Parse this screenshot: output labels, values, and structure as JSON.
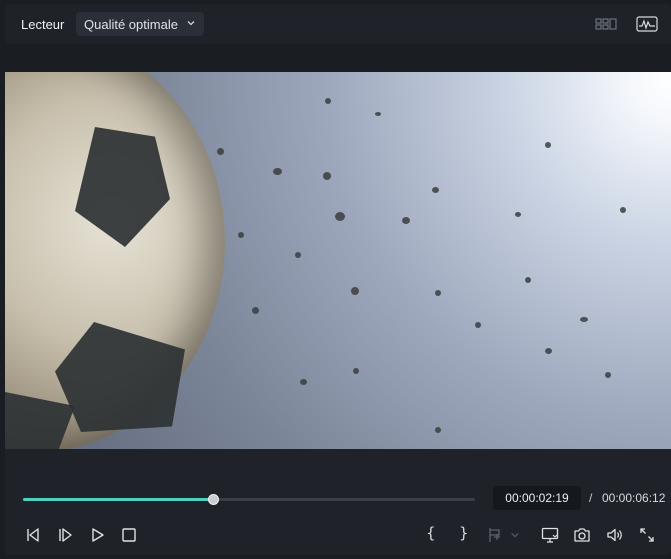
{
  "header": {
    "title": "Lecteur",
    "quality_selected": "Qualité optimale",
    "icons": [
      "layout-grid-icon",
      "waveform-icon"
    ]
  },
  "playback": {
    "current_time": "00:00:02:19",
    "separator": "/",
    "total_time": "00:00:06:12",
    "progress": 0.42
  },
  "controls": {
    "left": [
      "step-back-icon",
      "step-forward-icon",
      "play-icon",
      "stop-icon"
    ],
    "mark_in": "{",
    "mark_out": "}",
    "right": [
      "insert-marker-icon",
      "chevron-down-icon",
      "display-icon",
      "camera-icon",
      "volume-icon",
      "fullscreen-icon"
    ]
  },
  "colors": {
    "accent": "#4ed2c0",
    "panel": "#1f2329",
    "track": "#3a3f47"
  }
}
